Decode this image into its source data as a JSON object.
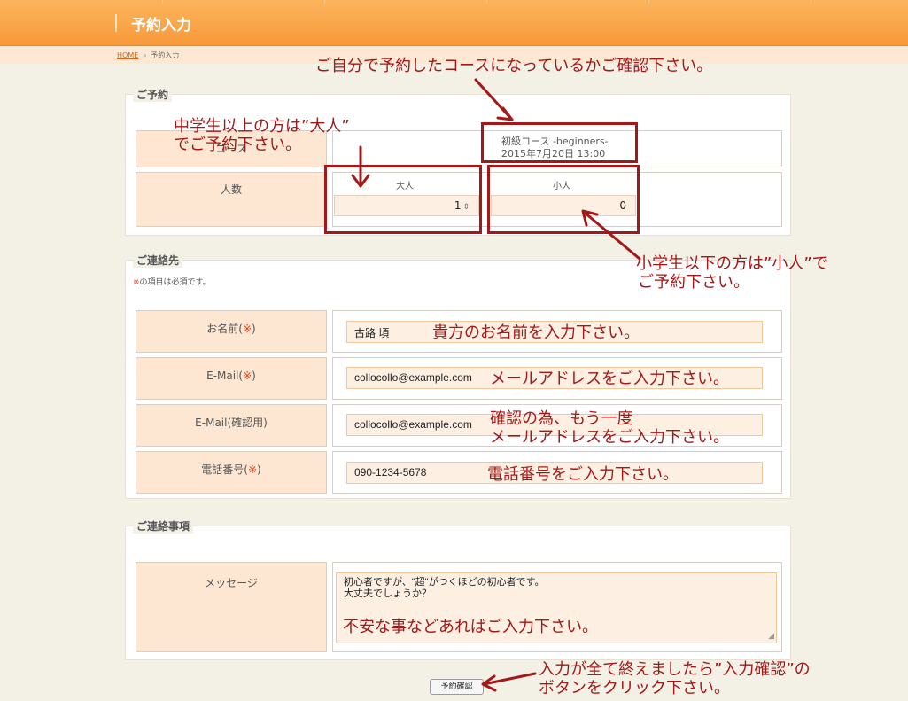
{
  "header": {
    "title": "予約入力"
  },
  "breadcrumb": {
    "home": "HOME",
    "separator": "»",
    "current": "予約入力"
  },
  "reservation": {
    "legend": "ご予約",
    "course_label": "コース",
    "course_name": "初級コース -beginners-",
    "course_datetime": "2015年7月20日 13:00",
    "people_label": "人数",
    "adult_label": "大人",
    "adult_value": "1",
    "child_label": "小人",
    "child_value": "0"
  },
  "contact": {
    "legend": "ご連絡先",
    "required_mark": "※",
    "required_note": "の項目は必須です。",
    "name_label": "お名前(",
    "email_label": "E-Mail(",
    "email_confirm_label": "E-Mail(確認用)",
    "phone_label": "電話番号(",
    "close_paren": ")",
    "name_value": "古路 頃",
    "email_value": "collocollo@example.com",
    "email_confirm_value": "collocollo@example.com",
    "phone_value": "090-1234-5678"
  },
  "message": {
    "legend": "ご連絡事項",
    "label": "メッセージ",
    "line1": "初心者ですが、\"超\"がつくほどの初心者です。",
    "line2": "大丈夫でしょうか？"
  },
  "submit_button": "予約確認",
  "annotations": {
    "course_check": "ご自分で予約したコースになっているかご確認下さい。",
    "adult_line1": "中学生以上の方は”大人”",
    "adult_line2": "でご予約下さい。",
    "child_line1": "小学生以下の方は”小人”で",
    "child_line2": "ご予約下さい。",
    "name_hint": "貴方のお名前を入力下さい。",
    "email_hint": "メールアドレスをご入力下さい。",
    "email_confirm_line1": "確認の為、もう一度",
    "email_confirm_line2": "メールアドレスをご入力下さい。",
    "phone_hint": "電話番号をご入力下さい。",
    "message_hint": "不安な事などあればご入力下さい。",
    "submit_line1": "入力が全て終えましたら”入力確認”の",
    "submit_line2": "ボタンをクリック下さい。"
  },
  "colors": {
    "header": "#f8993a",
    "label_bg": "#fde7d3",
    "annotation": "#a31818",
    "required": "#e53d17"
  }
}
